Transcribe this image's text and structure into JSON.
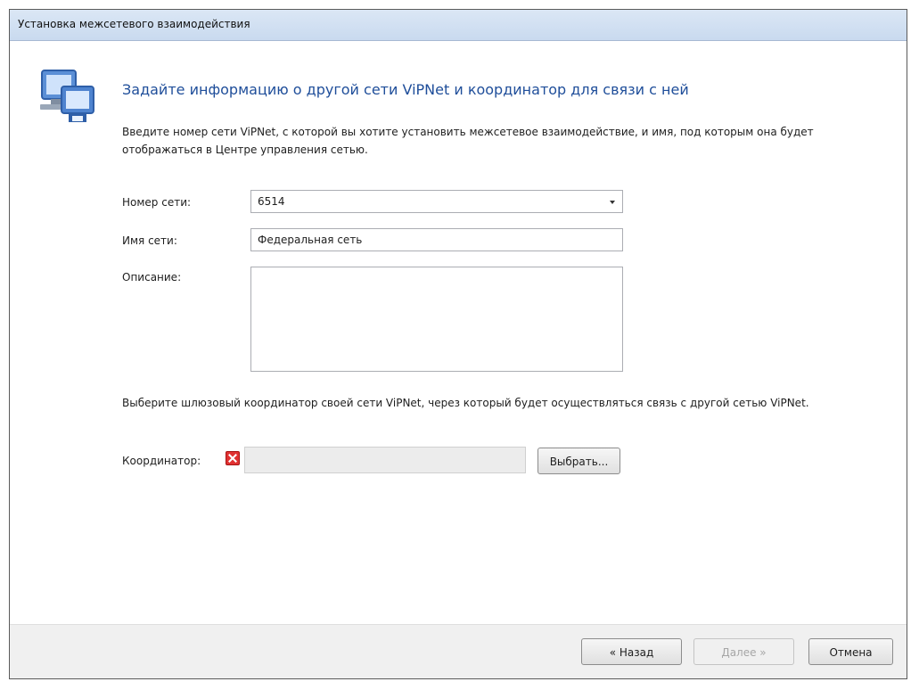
{
  "window": {
    "title": "Установка межсетевого взаимодействия"
  },
  "page": {
    "heading": "Задайте информацию о другой сети ViPNet и координатор для связи с ней",
    "description": "Введите номер сети ViPNet, с которой вы хотите установить межсетевое взаимодействие, и имя, под которым она будет отображаться в Центре управления сетью."
  },
  "form": {
    "network_number": {
      "label": "Номер сети:",
      "value": "6514"
    },
    "network_name": {
      "label": "Имя сети:",
      "value": "Федеральная сеть"
    },
    "description": {
      "label": "Описание:",
      "value": ""
    }
  },
  "coordinator": {
    "instruction": "Выберите шлюзовый координатор своей сети ViPNet, через который будет осуществляться связь с другой сетью ViPNet.",
    "label": "Координатор:",
    "value": "",
    "select_button": "Выбрать..."
  },
  "footer": {
    "back_button": "« Назад",
    "next_button": "Далее »",
    "cancel_button": "Отмена"
  },
  "colors": {
    "heading": "#1f4e9a",
    "error_icon": "#e03131"
  }
}
